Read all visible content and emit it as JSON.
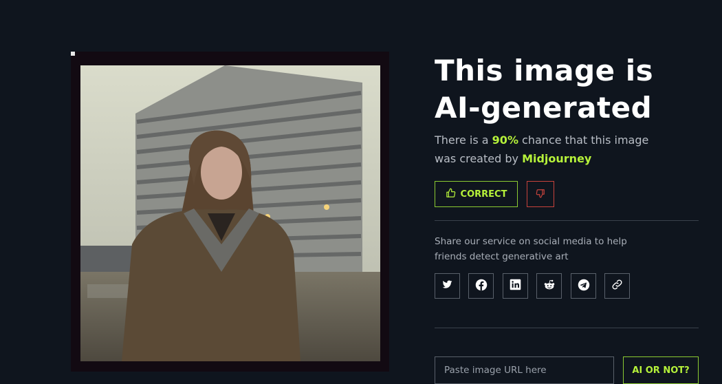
{
  "result": {
    "headline": "This image is AI-generated",
    "sub_prefix": "There is a ",
    "probability": "90%",
    "sub_middle": " chance that this image was created by ",
    "generator": "Midjourney"
  },
  "feedback": {
    "correct_label": "CORRECT",
    "correct_icon": "thumbs-up-icon",
    "wrong_icon": "thumbs-down-icon"
  },
  "share": {
    "text": "Share our service on social media to help friends detect generative art",
    "networks": [
      "twitter-icon",
      "facebook-icon",
      "linkedin-icon",
      "reddit-icon",
      "telegram-icon",
      "link-icon"
    ]
  },
  "check": {
    "placeholder": "Paste image URL here",
    "submit_label": "AI OR NOT?"
  },
  "colors": {
    "background": "#0f151e",
    "accent": "#b6f23a",
    "negative": "#c9433c"
  }
}
